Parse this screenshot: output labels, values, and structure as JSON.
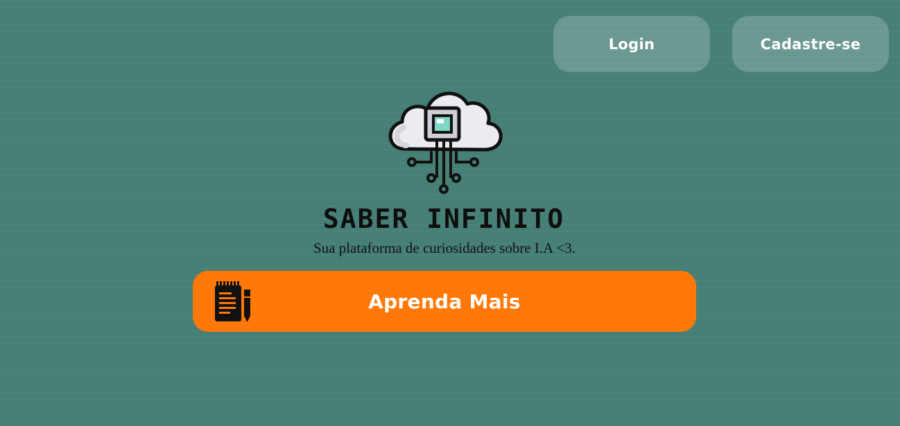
{
  "header": {
    "login_label": "Login",
    "signup_label": "Cadastre-se"
  },
  "hero": {
    "logo_icon": "cloud-chip-icon",
    "title": "SABER INFINITO",
    "subtitle": "Sua plataforma de curiosidades sobre I.A <3."
  },
  "cta": {
    "icon": "notepad-pencil-icon",
    "label": "Aprenda Mais"
  },
  "colors": {
    "background": "#467f75",
    "cta": "#ff7808",
    "nav_button": "rgba(255,255,255,0.20)",
    "chip_screen": "#7fd6c6"
  }
}
